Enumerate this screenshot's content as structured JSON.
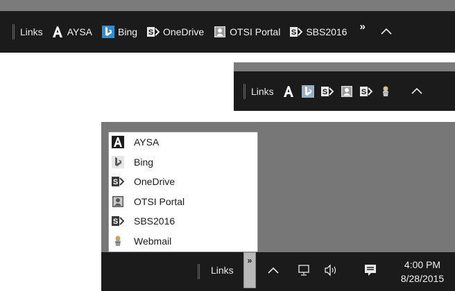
{
  "toolbar_label": "Links",
  "links": [
    {
      "label": "AYSA",
      "icon": "aysa-icon"
    },
    {
      "label": "Bing",
      "icon": "bing-icon"
    },
    {
      "label": "OneDrive",
      "icon": "sharepoint-icon"
    },
    {
      "label": "OTSI Portal",
      "icon": "portal-icon"
    },
    {
      "label": "SBS2016",
      "icon": "sharepoint-icon"
    },
    {
      "label": "Webmail",
      "icon": "webmail-icon"
    }
  ],
  "overflow_chevron": "»",
  "show_hidden_caret": "^",
  "clock": {
    "time": "4:00 PM",
    "date": "8/28/2015"
  },
  "colors": {
    "taskbar": "#1b1b1b",
    "desktop": "#777777",
    "bing": "#2f8fd3",
    "sharepoint_bg": "#e8e8e8"
  }
}
